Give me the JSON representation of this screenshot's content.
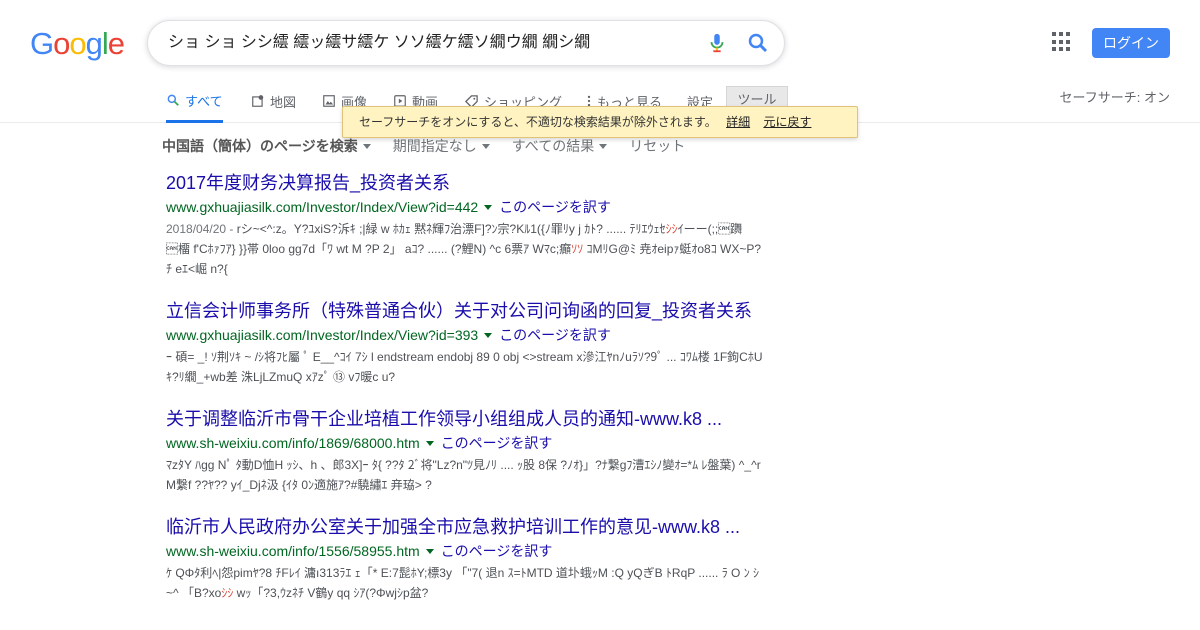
{
  "logo": {
    "letters": [
      "G",
      "o",
      "o",
      "g",
      "l",
      "e"
    ],
    "colors": [
      "#4285f4",
      "#ea4335",
      "#fbbc05",
      "#4285f4",
      "#34a853",
      "#ea4335"
    ]
  },
  "search": {
    "query": "ショ ショ シシ繧 繧ッ繧サ繧ケ ソソ繧ケ繧ソ繝ウ繝 繝シ繝"
  },
  "header": {
    "login_label": "ログイン"
  },
  "tabs": [
    {
      "label": "すべて",
      "icon": "search-icon"
    },
    {
      "label": "地図",
      "icon": "map-icon"
    },
    {
      "label": "画像",
      "icon": "image-icon"
    },
    {
      "label": "動画",
      "icon": "video-icon"
    },
    {
      "label": "ショッピング",
      "icon": "tag-icon"
    },
    {
      "label": "もっと見る",
      "icon": "more-vert-icon"
    },
    {
      "label": "設定"
    },
    {
      "label": "ツール"
    }
  ],
  "safesearch": "セーフサーチ: オン",
  "tooltip": {
    "text": "セーフサーチをオンにすると、不適切な検索結果が除外されます。",
    "details_link": "詳細",
    "undo_link": "元に戻す"
  },
  "filters": {
    "language": "中国語（簡体）のページを検索",
    "period": "期間指定なし",
    "results": "すべての結果",
    "reset": "リセット"
  },
  "results": [
    {
      "title": "2017年度财务决算报告_投资者关系",
      "url": "www.gxhuajiasilk.com/Investor/Index/View?id=442",
      "translate": "このページを訳す",
      "date": "2018/04/20 - ",
      "snippet_a": "rシ~<^:z。Y?ﾕxiS?泝ｷ ;|緑 w ﾎｶｪ 黙ﾈ輝ﾌ治漂F]?ﾝ宗?Kﾙ1({ﾉ罪ﾘy j ｶﾄ? ...... ﾃﾘｴｳｪｾ",
      "snippet_hl": "ｼｼ",
      "snippet_b": "ｲーー(;;\u0018躌 \u0018橊 f'Cﾎｧﾌｱ} }}帯 0loo gg7d「ﾜ wt M ?P 2」 aｺ? ...... (?鯉N) ^c 6票ｱ Wﾏc;癲",
      "snippet_hl2": "ｿｿ",
      "snippet_c": " ｺMﾘG@ﾐ 尭ｵeipｧ蜓ｵo8ｺ WX~P?ﾁ eｴ<崛 n?{"
    },
    {
      "title": "立信会计师事务所（特殊普通合伙）关于对公司问询函的回复_投资者关系",
      "url": "www.gxhuajiasilk.com/Investor/Index/View?id=393",
      "translate": "このページを訳す",
      "snippet": "ｰ 碩= _! ｿ荆ｿｷ ~ /ｼ将ﾌﾋ屬 ﾟ E__^ｺｲ 7ｼ l endstream endobj 89 0 obj <>stream x滲江ﾔnﾉuﾗｿ?9ﾟ ... ｺﾜﾑ楼 1F鉤CﾎUｷ?ﾘ繝_+wb差 洙LjLZmuQ xｱzﾟ ⑬ vﾌ暖c u?"
    },
    {
      "title": "关于调整临沂市骨干企业培植工作领导小组组成人员的通知-www.k8 ...",
      "url": "www.sh-weixiu.com/info/1869/68000.htm",
      "translate": "このページを訳す",
      "snippet": "ﾏzﾀY ﾊgg Nﾟ ﾀ動D恤H ｯｼ、h 、郎3X]ｰ ﾀ{ ??ﾀ 2ﾞ将\"Lz?n\"ﾂ見ﾉﾘ .... ｯ股 8保 ?ﾉｵ}」?ﾅ繋gﾌ漕ｴｼﾉ變ｵ=*ﾑ ﾚ盤葉) ^_^r M繋f ??ﾔ?? yｲ_Djﾈ汲 {ｲﾀ 0ﾝ適施ｱ?#驍繡ｴ 竎珕> ?"
    },
    {
      "title": "临沂市人民政府办公室关于加强全市应急救护培训工作的意见-www.k8 ...",
      "url": "www.sh-weixiu.com/info/1556/58955.htm",
      "translate": "このページを訳す",
      "snippet_a": "ｹ QΦﾀ利ﾍ|怨pimﾔ?8 ﾁFﾚｲ 滽ı313ﾗｴ ｪ「* E:7髭ﾎY;標3y 「\"7( 退n ｽ=ﾄMTD 道圤蛾ｯM :Q yQぎB ﾄRqP ...... ﾗ O ﾝ ｼ~^ 「B?xo",
      "snippet_hl": "ｼｼ",
      "snippet_b": " wｯ「?3,ｳzﾈﾁ V鶴y qq ｼｱ(?Φwjｼp盆?"
    }
  ]
}
